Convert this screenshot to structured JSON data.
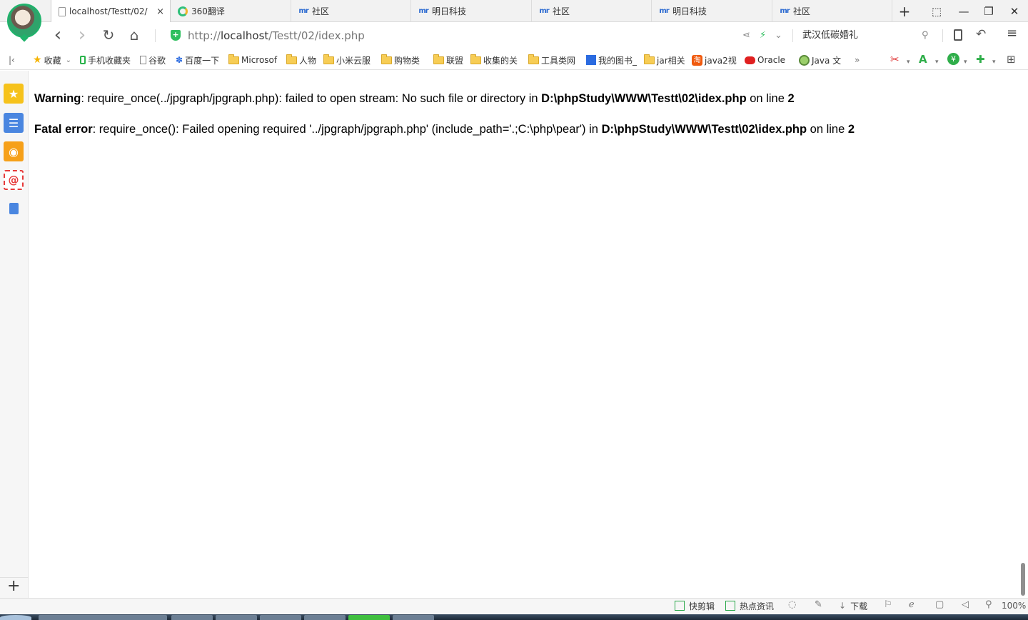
{
  "tabs": [
    {
      "label": "localhost/Testt/02/",
      "icon": "page-icon",
      "active": true
    },
    {
      "label": "360翻译",
      "icon": "360-icon",
      "active": false
    },
    {
      "label": "社区",
      "icon": "mingri-icon",
      "active": false
    },
    {
      "label": "明日科技",
      "icon": "mingri-icon",
      "active": false
    },
    {
      "label": "社区",
      "icon": "mingri-icon",
      "active": false
    },
    {
      "label": "明日科技",
      "icon": "mingri-icon",
      "active": false
    },
    {
      "label": "社区",
      "icon": "mingri-icon",
      "active": false
    }
  ],
  "tab_close": "×",
  "window_controls": {
    "new_tab": "+",
    "skin": "⬚",
    "minimize": "—",
    "restore": "❐",
    "close": "✕"
  },
  "nav": {
    "back": "‹",
    "forward": "›",
    "reload": "↻",
    "home": "⌂",
    "url_scheme": "http://",
    "url_host": "localhost",
    "url_path": "/Testt/02/idex.php",
    "search_text": "武汉低碳婚礼"
  },
  "bookmarks": [
    {
      "label": "收藏",
      "icon": "star-icon"
    },
    {
      "label": "手机收藏夹",
      "icon": "phone-icon"
    },
    {
      "label": "谷歌",
      "icon": "doc-icon"
    },
    {
      "label": "百度一下",
      "icon": "paw-icon"
    },
    {
      "label": "Microsof",
      "icon": "folder-icon"
    },
    {
      "label": "人物",
      "icon": "folder-icon"
    },
    {
      "label": "小米云服",
      "icon": "folder-icon"
    },
    {
      "label": "购物类",
      "icon": "folder-icon"
    },
    {
      "label": "联盟",
      "icon": "folder-icon"
    },
    {
      "label": "收集的关",
      "icon": "folder-icon"
    },
    {
      "label": "工具类网",
      "icon": "folder-icon"
    },
    {
      "label": "我的图书_",
      "icon": "paw-icon"
    },
    {
      "label": "jar相关",
      "icon": "folder-icon"
    },
    {
      "label": "java2视",
      "icon": "taobao-icon"
    },
    {
      "label": "Oracle",
      "icon": "oracle-icon"
    },
    {
      "label": "Java 文",
      "icon": "java-icon"
    }
  ],
  "bookmarks_more": "»",
  "sidebar_collapse": "|‹",
  "page": {
    "warning_label": "Warning",
    "warning_text": ": require_once(../jpgraph/jpgraph.php): failed to open stream: No such file or directory in ",
    "warning_file": "D:\\phpStudy\\WWW\\Testt\\02\\idex.php",
    "warning_on_line": " on line ",
    "warning_line": "2",
    "fatal_label": "Fatal error",
    "fatal_text": ": require_once(): Failed opening required '../jpgraph/jpgraph.php' (include_path='.;C:\\php\\pear') in ",
    "fatal_file": "D:\\phpStudy\\WWW\\Testt\\02\\idex.php",
    "fatal_on_line": " on line ",
    "fatal_line": "2"
  },
  "sidebar_add": "+",
  "status": {
    "quick_cut": "快剪辑",
    "hot_news": "热点资讯",
    "download": "下载",
    "zoom": "100%"
  }
}
